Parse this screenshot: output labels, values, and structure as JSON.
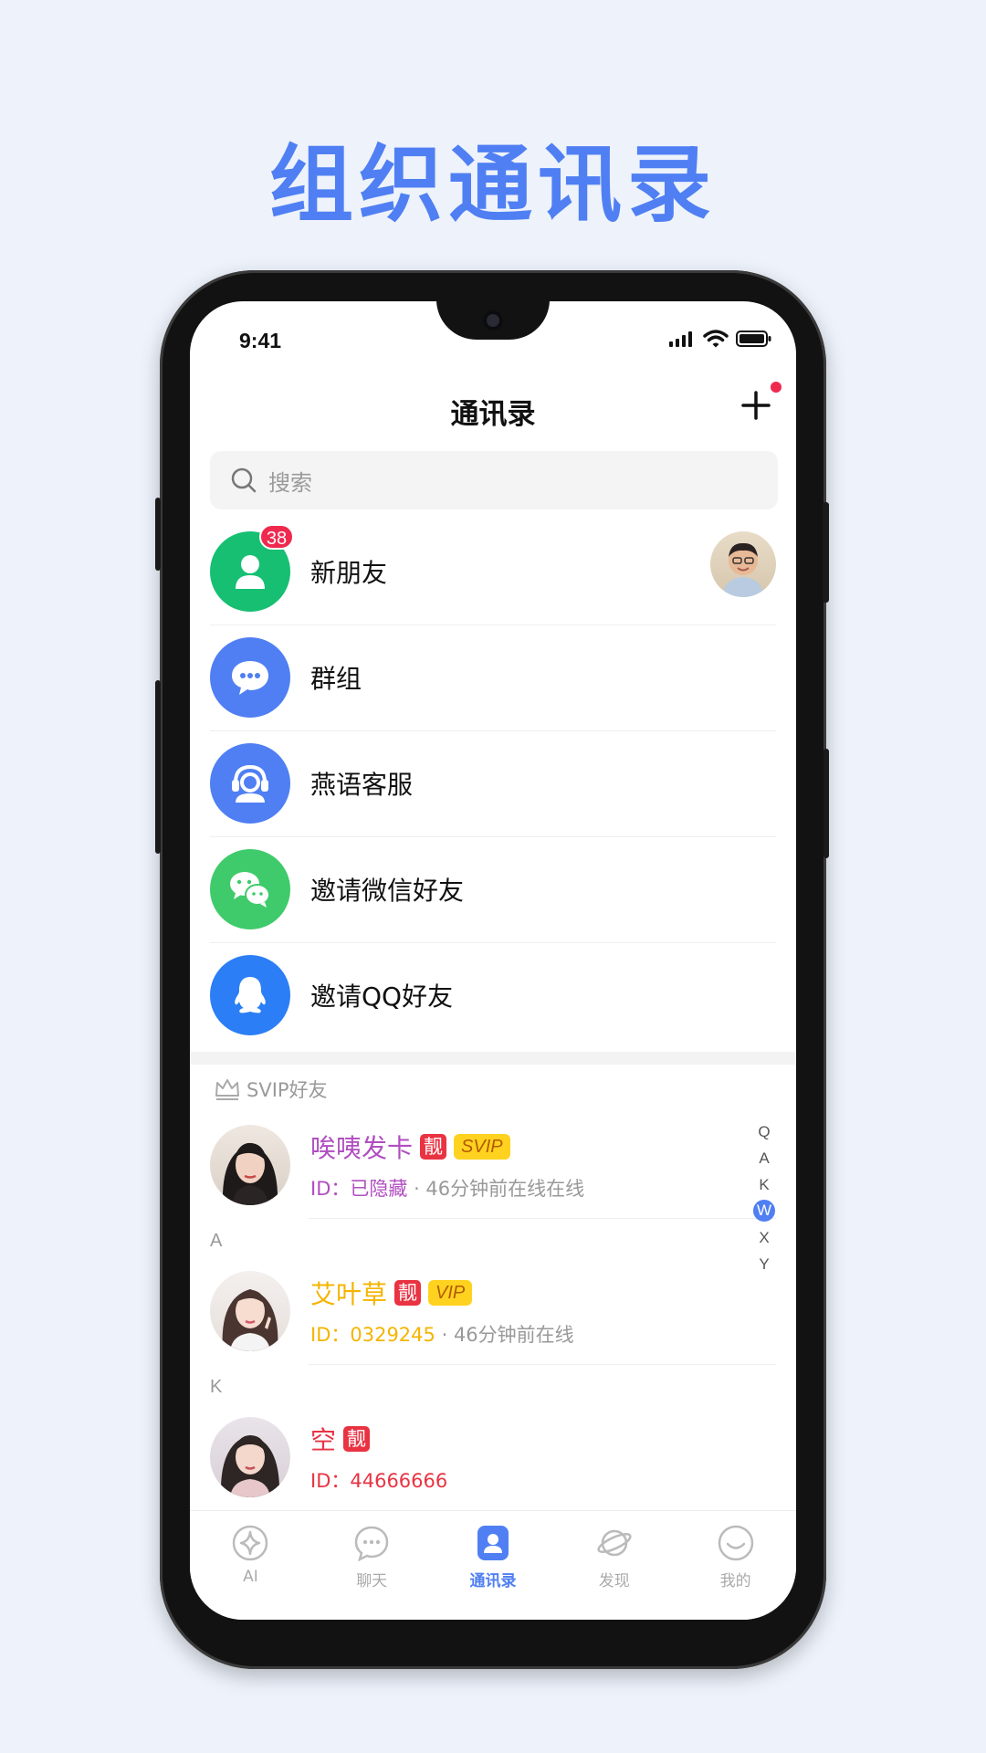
{
  "promo": {
    "title": "组织通讯录"
  },
  "status_bar": {
    "time": "9:41"
  },
  "header": {
    "title": "通讯录"
  },
  "search": {
    "placeholder": "搜索"
  },
  "entries": [
    {
      "label": "新朋友",
      "icon": "person-icon",
      "color": "#16bf72",
      "badge": "38"
    },
    {
      "label": "群组",
      "icon": "chat-bubble-icon",
      "color": "#4f7ff3"
    },
    {
      "label": "燕语客服",
      "icon": "headset-icon",
      "color": "#4f7ff3"
    },
    {
      "label": "邀请微信好友",
      "icon": "wechat-icon",
      "color": "#3fcb6b"
    },
    {
      "label": "邀请QQ好友",
      "icon": "qq-icon",
      "color": "#2b7ef5"
    }
  ],
  "svip_section": {
    "title": "SVIP好友"
  },
  "friends": [
    {
      "name": "唉咦发卡",
      "name_color": "#b04ec0",
      "liang": "靓",
      "vip": "SVIP",
      "id": "ID：已隐藏",
      "status": "46分钟前在线在线"
    },
    {
      "name": "艾叶草",
      "name_color": "#f4b400",
      "liang": "靓",
      "vip": "VIP",
      "id": "ID：0329245",
      "status": "46分钟前在线"
    },
    {
      "name": "空",
      "name_color": "#e93343",
      "liang": "靓",
      "id": "ID：44666666"
    }
  ],
  "letters": [
    "A",
    "K"
  ],
  "index": [
    "Q",
    "A",
    "K",
    "W",
    "X",
    "Y"
  ],
  "index_active": "W",
  "tabs": [
    {
      "label": "AI",
      "icon": "ai-sparkle-icon"
    },
    {
      "label": "聊天",
      "icon": "chat-icon"
    },
    {
      "label": "通讯录",
      "icon": "contacts-icon",
      "active": true
    },
    {
      "label": "发现",
      "icon": "planet-icon"
    },
    {
      "label": "我的",
      "icon": "profile-face-icon"
    }
  ],
  "colors": {
    "accent": "#4f7ff3",
    "badge": "#f0294f",
    "liang": "#e93343",
    "vip": "#ffd21f"
  }
}
